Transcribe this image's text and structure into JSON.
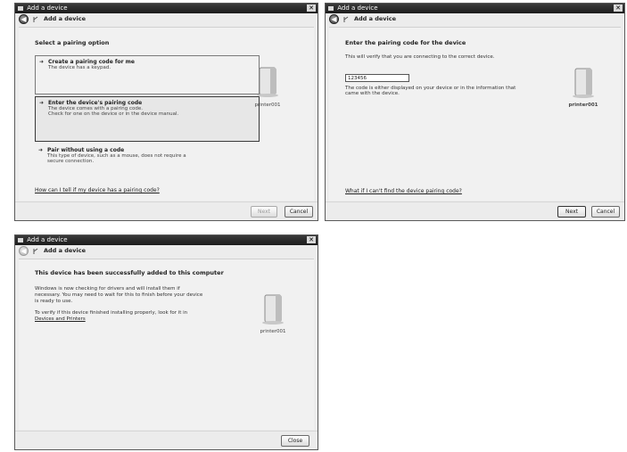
{
  "dialog1": {
    "title": "Add a device",
    "close": "✕",
    "nav_title": "Add a device",
    "heading": "Select a pairing option",
    "options": [
      {
        "title": "Create a pairing code for me",
        "desc": "The device has a keypad."
      },
      {
        "title": "Enter the device's pairing code",
        "desc1": "The device comes with a pairing code.",
        "desc2": "Check for one on the device or in the device manual."
      },
      {
        "title": "Pair without using a code",
        "desc1": "This type of device, such as a mouse, does not require a",
        "desc2": "secure connection."
      }
    ],
    "link": "How can I tell if my device has a pairing code?",
    "device_name": "printer001",
    "next_label": "Next",
    "cancel_label": "Cancel"
  },
  "dialog2": {
    "title": "Add a device",
    "close": "✕",
    "nav_title": "Add a device",
    "heading": "Enter the pairing code for the device",
    "subtext": "This will verify that you are connecting to the correct device.",
    "code_value": "123456",
    "helper1": "The code is either displayed on your device or in the information that",
    "helper2": "came with the device.",
    "link": "What if I can't find the device pairing code?",
    "device_name": "printer001",
    "next_label": "Next",
    "cancel_label": "Cancel"
  },
  "dialog3": {
    "title": "Add a device",
    "close": "✕",
    "nav_title": "Add a device",
    "heading": "This device has been successfully added to this computer",
    "para1": [
      "Windows is now checking for drivers and will install them if",
      "necessary. You may need to wait for this to finish before your device",
      "is ready to use."
    ],
    "para2_line1": "To verify if this device finished installing properly, look for it in",
    "para2_link": "Devices and Printers",
    "device_name": "printer001",
    "close_label": "Close"
  },
  "icons": {
    "back": "◀",
    "arrow": "➜"
  }
}
